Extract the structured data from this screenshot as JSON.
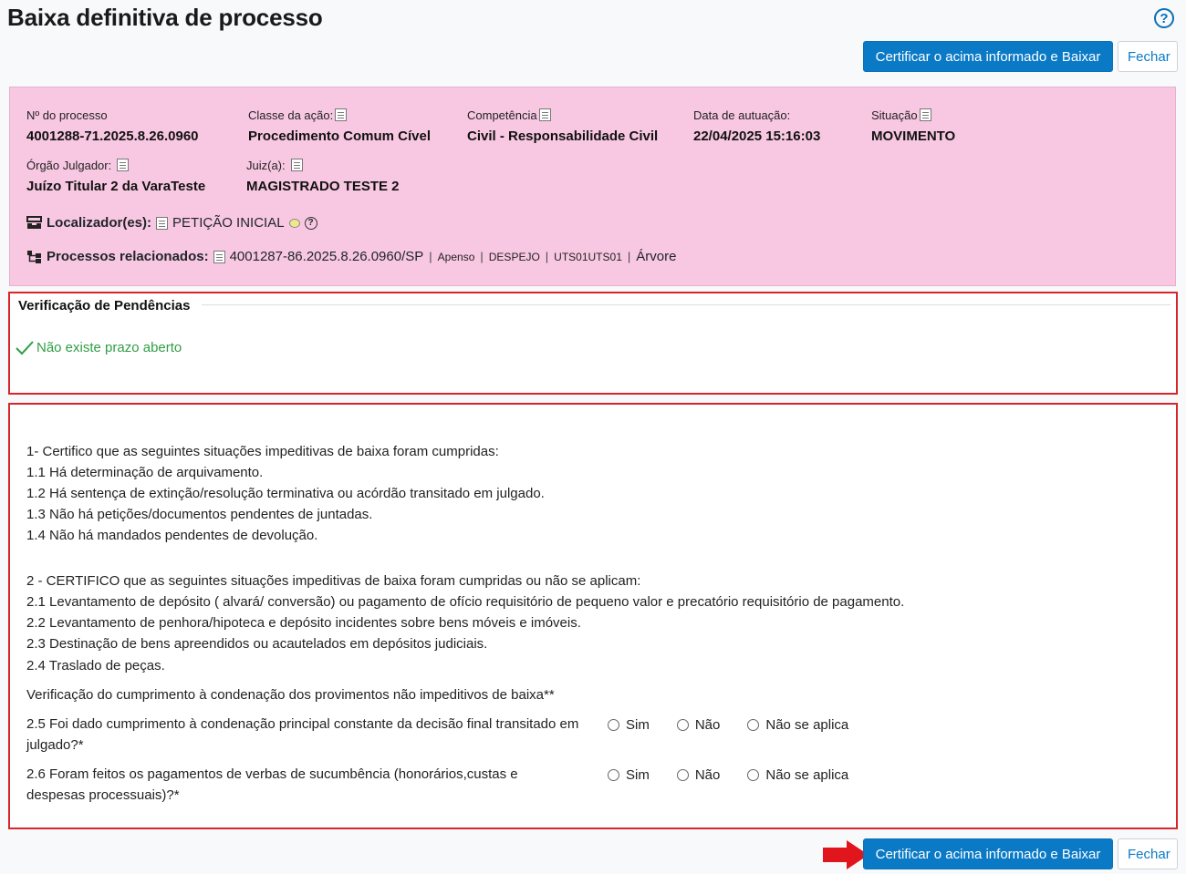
{
  "header": {
    "title": "Baixa definitiva de processo",
    "help_icon": "?"
  },
  "toolbar": {
    "certify_label": "Certificar o acima informado e Baixar",
    "close_label": "Fechar"
  },
  "process": {
    "numero_label": "Nº do processo",
    "numero_value": "4001288-71.2025.8.26.0960",
    "classe_label": "Classe da ação:",
    "classe_value": "Procedimento Comum Cível",
    "competencia_label": "Competência",
    "competencia_value": "Civil - Responsabilidade Civil",
    "data_label": "Data de autuação:",
    "data_value": "22/04/2025 15:16:03",
    "situacao_label": "Situação",
    "situacao_value": "MOVIMENTO",
    "orgao_label": "Órgão Julgador:",
    "orgao_value": "Juízo Titular 2 da VaraTeste",
    "juiz_label": "Juiz(a):",
    "juiz_value": "MAGISTRADO TESTE 2",
    "localizador_label": "Localizador(es):",
    "localizador_value": "PETIÇÃO INICIAL",
    "relacionados_label": "Processos relacionados:",
    "relacionado_numero": "4001287-86.2025.8.26.0960/SP",
    "relacionado_tipo": "Apenso",
    "relacionado_classe": "DESPEJO",
    "relacionado_orgao": "UTS01UTS01",
    "relacionado_arvore": "Árvore",
    "separator": "|"
  },
  "pendencias": {
    "title": "Verificação de Pendências",
    "status": "Não existe prazo aberto",
    "status_color": "#2f9e44"
  },
  "certificacao": {
    "lines1": [
      "1- Certifico que as seguintes situações impeditivas de baixa foram cumpridas:",
      "1.1 Há determinação de arquivamento.",
      "1.2 Há sentença de extinção/resolução terminativa ou acórdão transitado em julgado.",
      "1.3 Não há petições/documentos pendentes de juntadas.",
      "1.4 Não há mandados pendentes de devolução."
    ],
    "lines2": [
      "2 - CERTIFICO que as seguintes situações impeditivas de baixa foram cumpridas ou não se aplicam:",
      "2.1 Levantamento de depósito ( alvará/ conversão) ou pagamento de ofício requisitório de pequeno valor e precatório requisitório de pagamento.",
      "2.2 Levantamento de penhora/hipoteca e depósito incidentes sobre bens móveis e imóveis.",
      "2.3 Destinação de bens apreendidos ou acautelados em depósitos judiciais.",
      "2.4 Traslado de peças."
    ],
    "verificacao": "Verificação do cumprimento à condenação dos provimentos não impeditivos de baixa**",
    "questions": [
      "2.5 Foi dado cumprimento à condenação principal constante da decisão final transitado em julgado?*",
      "2.6 Foram feitos os pagamentos de verbas de sucumbência (honorários,custas e despesas processuais)?*"
    ],
    "options": [
      "Sim",
      "Não",
      "Não se aplica"
    ]
  },
  "colors": {
    "primary": "#0b7ac6",
    "panel_bg": "#f8c8e2",
    "highlight_border": "#d8242a",
    "arrow": "#e0161c"
  },
  "icons": {
    "help": "help-circle-icon",
    "field_info": "list-details-icon",
    "localizador": "tray-icon",
    "relacionados": "hierarchy-icon",
    "check": "check-icon",
    "arrow": "red-arrow-icon"
  }
}
